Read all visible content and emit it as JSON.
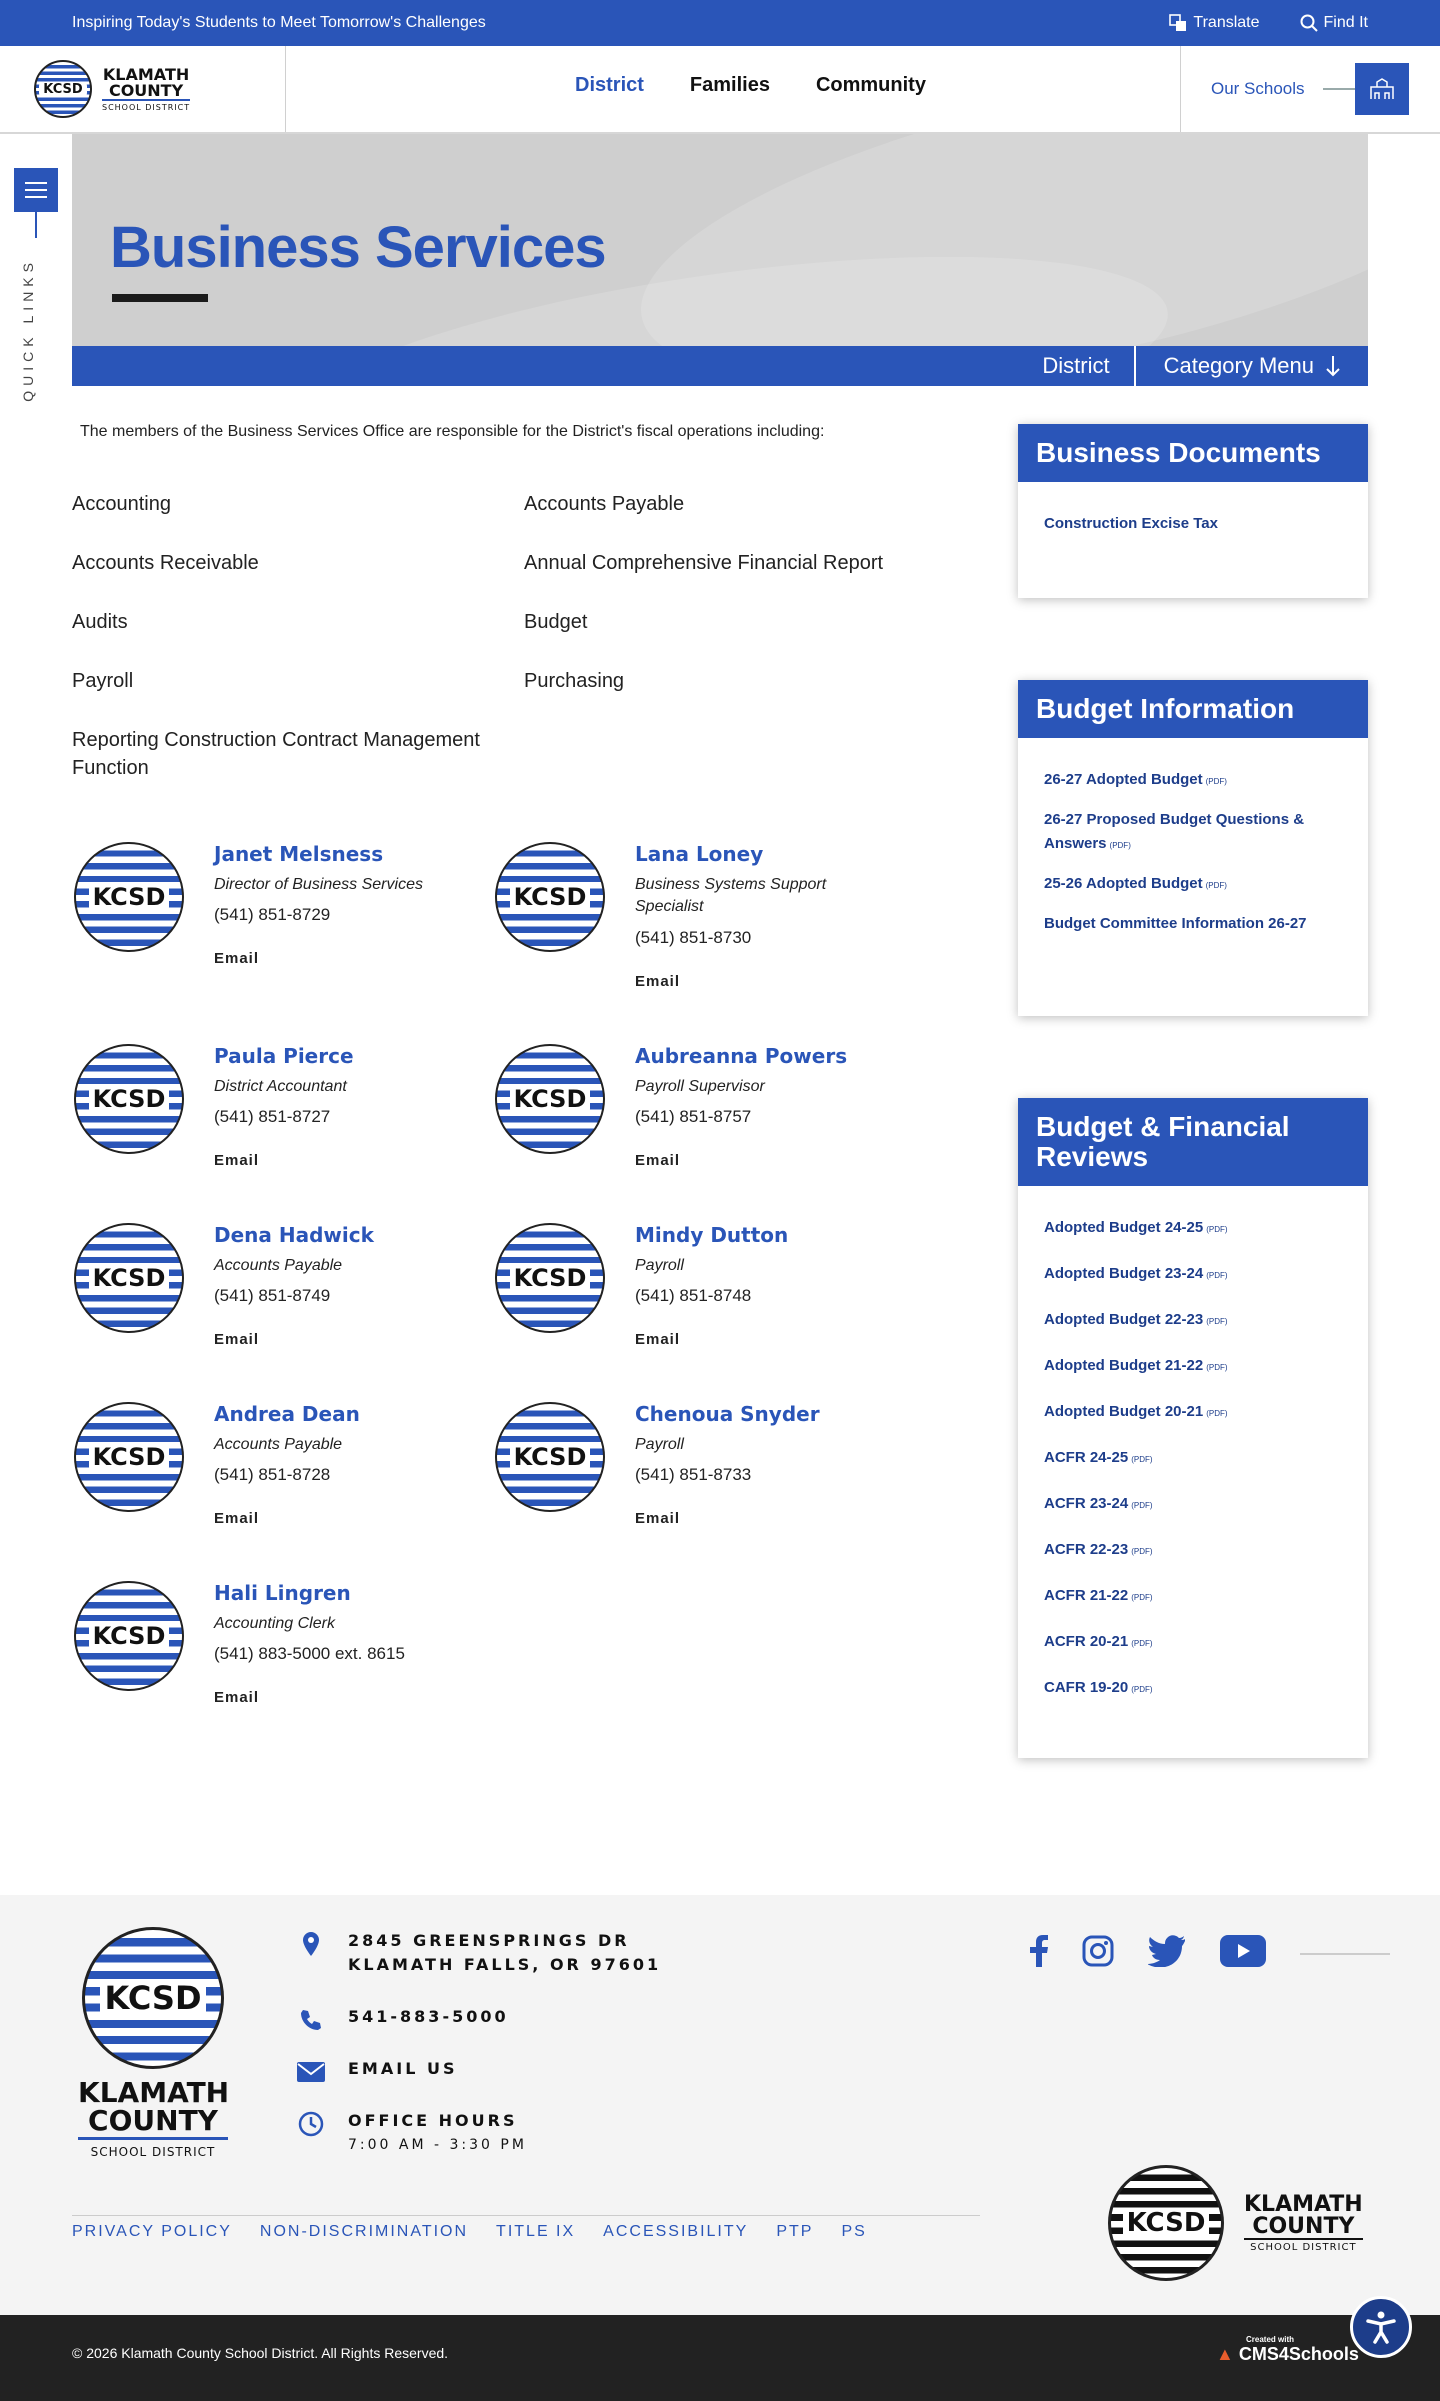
{
  "topbar": {
    "tagline": "Inspiring Today's Students to Meet Tomorrow's Challenges",
    "translate": "Translate",
    "find": "Find It"
  },
  "logo": {
    "seal": "KCSD",
    "line1": "KLAMATH",
    "line2": "COUNTY",
    "line3": "SCHOOL DISTRICT"
  },
  "nav": {
    "items": [
      "District",
      "Families",
      "Community"
    ],
    "schools": "Our Schools"
  },
  "quicklinks": {
    "label": "QUICK LINKS"
  },
  "hero": {
    "title": "Business Services"
  },
  "crumb": {
    "district": "District",
    "category": "Category Menu"
  },
  "intro": "The members of the Business Services Office are responsible for the District's fiscal operations including:",
  "services": [
    "Accounting",
    "Accounts Payable",
    "Accounts Receivable",
    "Annual Comprehensive Financial Report",
    "Audits",
    "Budget",
    "Payroll",
    "Purchasing",
    "Reporting Construction Contract Management Function"
  ],
  "staff": [
    {
      "name": "Janet Melsness",
      "title": "Director of Business Services",
      "phone": "(541) 851-8729",
      "email": "Email"
    },
    {
      "name": "Lana Loney",
      "title": "Business Systems Support Specialist",
      "phone": "(541) 851-8730",
      "email": "Email"
    },
    {
      "name": "Paula Pierce",
      "title": "District Accountant",
      "phone": "(541) 851-8727",
      "email": "Email"
    },
    {
      "name": "Aubreanna Powers",
      "title": "Payroll Supervisor",
      "phone": "(541) 851-8757",
      "email": "Email"
    },
    {
      "name": "Dena Hadwick",
      "title": "Accounts Payable",
      "phone": "(541) 851-8749",
      "email": "Email"
    },
    {
      "name": "Mindy Dutton",
      "title": "Payroll",
      "phone": "(541) 851-8748",
      "email": "Email"
    },
    {
      "name": "Andrea Dean",
      "title": "Accounts Payable",
      "phone": "(541) 851-8728",
      "email": "Email"
    },
    {
      "name": "Chenoua Snyder",
      "title": "Payroll",
      "phone": "(541) 851-8733",
      "email": "Email"
    },
    {
      "name": "Hali Lingren",
      "title": "Accounting Clerk",
      "phone": "(541) 883-5000 ext. 8615",
      "email": "Email"
    }
  ],
  "sidebar": {
    "documents": {
      "title": "Business Documents",
      "items": [
        "Construction Excise Tax"
      ]
    },
    "budget": {
      "title": "Budget Information",
      "items": [
        "26-27 Adopted Budget",
        "26-27 Proposed Budget Questions & Answers",
        "25-26 Adopted Budget",
        "Budget Committee Information 26-27"
      ],
      "pdf": "(PDF)"
    },
    "reviews": {
      "title": "Budget & Financial Reviews",
      "items": [
        "Adopted Budget 24-25",
        "Adopted Budget 23-24",
        "Adopted Budget 22-23",
        "Adopted Budget 21-22",
        "Adopted Budget 20-21",
        "ACFR 24-25",
        "ACFR 23-24",
        "ACFR 22-23",
        "ACFR 21-22",
        "ACFR 20-21",
        "CAFR 19-20"
      ],
      "pdf": "(PDF)"
    }
  },
  "footer": {
    "address1": "2845 GREENSPRINGS DR",
    "address2": "KLAMATH FALLS, OR 97601",
    "phone": "541-883-5000",
    "email": "EMAIL US",
    "hours_label": "OFFICE HOURS",
    "hours": "7:00 AM - 3:30 PM",
    "links": [
      "PRIVACY POLICY",
      "NON-DISCRIMINATION",
      "TITLE IX",
      "ACCESSIBILITY",
      "PTP",
      "PS"
    ],
    "copyright": "© 2026 Klamath County School District. All Rights Reserved.",
    "cms_small": "Created with",
    "cms": "CMS4Schools"
  },
  "colors": {
    "brand": "#2a55b8",
    "dark": "#222222"
  }
}
